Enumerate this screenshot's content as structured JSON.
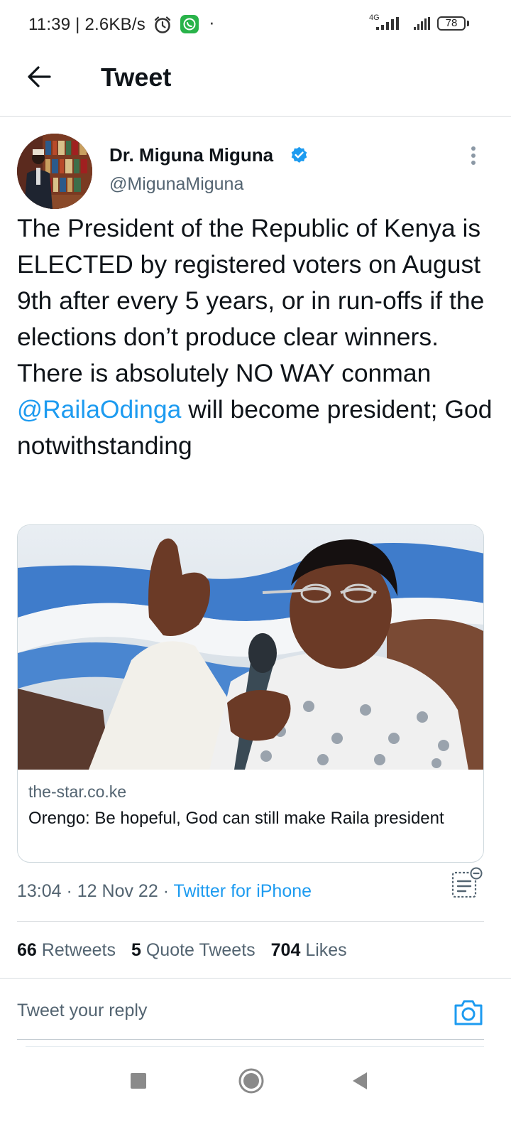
{
  "status_bar": {
    "text": "11:39 | 2.6KB/s",
    "network": "4G",
    "battery": "78"
  },
  "header": {
    "title": "Tweet"
  },
  "author": {
    "name": "Dr. Miguna Miguna",
    "handle": "@MigunaMiguna",
    "verified": true
  },
  "tweet": {
    "text_before": "The President of the Republic of Kenya is ELECTED by registered voters on August 9th after every 5 years, or in run-offs if the elections don’t produce clear winners. There is absolutely NO WAY conman ",
    "mention": "@RailaOdinga",
    "text_after": " will become president; God notwithstanding"
  },
  "card": {
    "domain": "the-star.co.ke",
    "title": "Orengo: Be hopeful, God can still make Raila president"
  },
  "meta": {
    "time": "13:04 · 12 Nov 22 · ",
    "source": "Twitter for iPhone"
  },
  "stats": {
    "retweets_count": "66",
    "retweets_label": "Retweets",
    "quotes_count": "5",
    "quotes_label": "Quote Tweets",
    "likes_count": "704",
    "likes_label": "Likes"
  },
  "reply": {
    "placeholder": "Tweet your reply"
  },
  "colors": {
    "accent": "#1d9bf0",
    "secondary_text": "#536471",
    "primary_text": "#0f1419"
  }
}
